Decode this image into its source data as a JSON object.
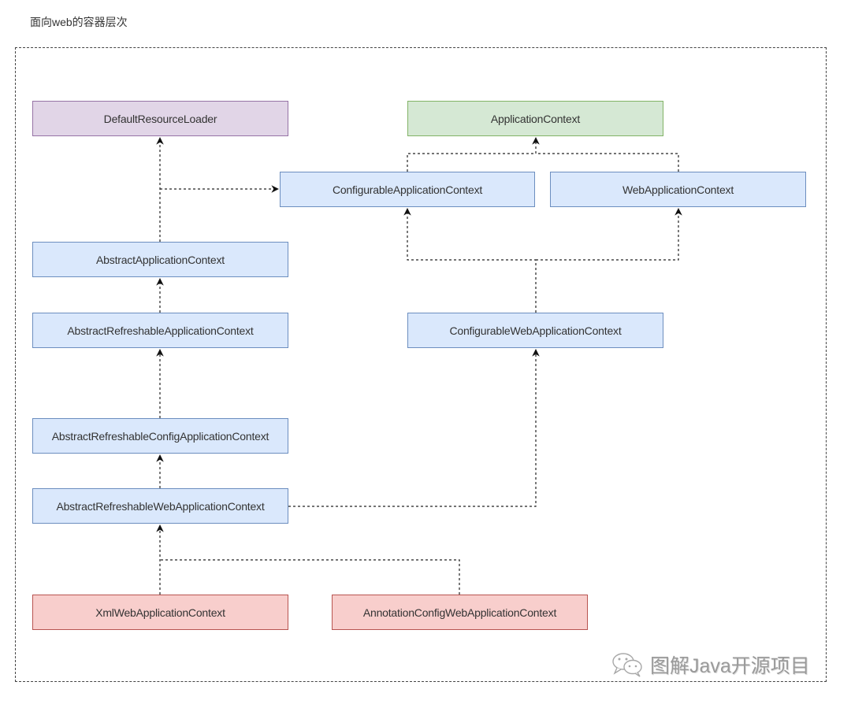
{
  "title": "面向web的容器层次",
  "colors": {
    "interface_fill": "#dae8fc",
    "interface_border": "#6c8ebf",
    "root_fill": "#d5e8d4",
    "root_border": "#82b366",
    "loader_fill": "#e1d5e7",
    "loader_border": "#9673a6",
    "concrete_fill": "#f8cecc",
    "concrete_border": "#b85450"
  },
  "nodes": {
    "default_resource_loader": "DefaultResourceLoader",
    "application_context": "ApplicationContext",
    "configurable_application_context": "ConfigurableApplicationContext",
    "web_application_context": "WebApplicationContext",
    "abstract_application_context": "AbstractApplicationContext",
    "abstract_refreshable_application_context": "AbstractRefreshableApplicationContext",
    "configurable_web_application_context": "ConfigurableWebApplicationContext",
    "abstract_refreshable_config_application_context": "AbstractRefreshableConfigApplicationContext",
    "abstract_refreshable_web_application_context": "AbstractRefreshableWebApplicationContext",
    "xml_web_application_context": "XmlWebApplicationContext",
    "annotation_config_web_application_context": "AnnotationConfigWebApplicationContext"
  },
  "edges": [
    {
      "from": "AbstractApplicationContext",
      "to": "DefaultResourceLoader",
      "style": "dashed"
    },
    {
      "from": "AbstractApplicationContext",
      "to": "ConfigurableApplicationContext",
      "style": "dashed"
    },
    {
      "from": "ConfigurableApplicationContext",
      "to": "ApplicationContext",
      "style": "dashed"
    },
    {
      "from": "WebApplicationContext",
      "to": "ApplicationContext",
      "style": "dashed"
    },
    {
      "from": "ConfigurableWebApplicationContext",
      "to": "ConfigurableApplicationContext",
      "style": "dashed"
    },
    {
      "from": "ConfigurableWebApplicationContext",
      "to": "WebApplicationContext",
      "style": "dashed"
    },
    {
      "from": "AbstractRefreshableApplicationContext",
      "to": "AbstractApplicationContext",
      "style": "dashed"
    },
    {
      "from": "AbstractRefreshableConfigApplicationContext",
      "to": "AbstractRefreshableApplicationContext",
      "style": "dashed"
    },
    {
      "from": "AbstractRefreshableWebApplicationContext",
      "to": "AbstractRefreshableConfigApplicationContext",
      "style": "dashed"
    },
    {
      "from": "AbstractRefreshableWebApplicationContext",
      "to": "ConfigurableWebApplicationContext",
      "style": "dashed"
    },
    {
      "from": "XmlWebApplicationContext",
      "to": "AbstractRefreshableWebApplicationContext",
      "style": "dashed"
    },
    {
      "from": "AnnotationConfigWebApplicationContext",
      "to": "AbstractRefreshableWebApplicationContext",
      "style": "dashed"
    }
  ],
  "watermark": {
    "icon": "wechat-icon",
    "text": "图解Java开源项目"
  }
}
